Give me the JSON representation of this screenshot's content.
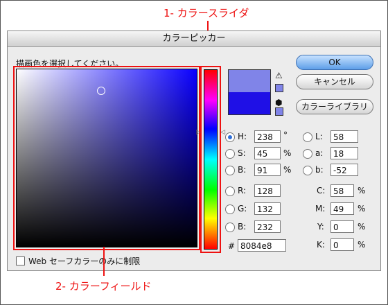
{
  "callouts": {
    "slider": "1- カラースライダ",
    "field": "2- カラーフィールド"
  },
  "dialog": {
    "title": "カラーピッカー",
    "prompt": "描画色を選択してください。",
    "web_only_label": "Web セーフカラーのみに制限",
    "buttons": {
      "ok": "OK",
      "cancel": "キャンセル",
      "libraries": "カラーライブラリ"
    }
  },
  "colors": {
    "new_color": "#8084e8",
    "current_color": "#1f10e6",
    "accent": "#e11"
  },
  "icons": {
    "gamut_warning": "warning-triangle-icon",
    "web_cube": "cube-icon"
  },
  "hsb": {
    "h_label": "H:",
    "h_value": "238",
    "h_unit": "°",
    "s_label": "S:",
    "s_value": "45",
    "s_unit": "%",
    "b_label": "B:",
    "b_value": "91",
    "b_unit": "%"
  },
  "lab": {
    "l_label": "L:",
    "l_value": "58",
    "a_label": "a:",
    "a_value": "18",
    "b_label": "b:",
    "b_value": "-52"
  },
  "rgb": {
    "r_label": "R:",
    "r_value": "128",
    "g_label": "G:",
    "g_value": "132",
    "b_label": "B:",
    "b_value": "232"
  },
  "cmyk": {
    "c_label": "C:",
    "c_value": "58",
    "c_unit": "%",
    "m_label": "M:",
    "m_value": "49",
    "m_unit": "%",
    "y_label": "Y:",
    "y_value": "0",
    "y_unit": "%",
    "k_label": "K:",
    "k_value": "0",
    "k_unit": "%"
  },
  "hex": {
    "label": "#",
    "value": "8084e8"
  }
}
